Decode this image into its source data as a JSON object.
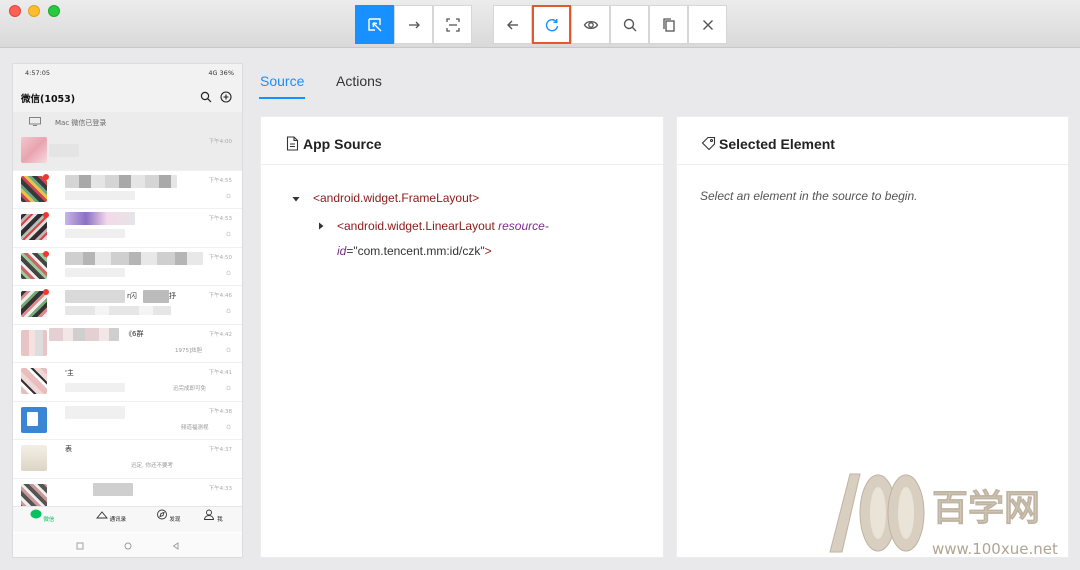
{
  "toolbar": {
    "buttons": [
      {
        "name": "select-element-button",
        "icon": "select-arrow-icon",
        "active": true
      },
      {
        "name": "swipe-button",
        "icon": "swipe-arrow-icon"
      },
      {
        "name": "tap-by-coordinates-button",
        "icon": "crop-frame-icon"
      },
      {
        "name": "back-button",
        "icon": "arrow-left-icon"
      },
      {
        "name": "refresh-button",
        "icon": "refresh-icon",
        "highlighted": true
      },
      {
        "name": "toggle-visibility-button",
        "icon": "eye-icon"
      },
      {
        "name": "search-button",
        "icon": "magnifier-icon"
      },
      {
        "name": "copy-xml-button",
        "icon": "copy-icon"
      },
      {
        "name": "quit-session-button",
        "icon": "close-icon"
      }
    ]
  },
  "tabs": {
    "source": "Source",
    "actions": "Actions"
  },
  "app_source": {
    "title": "App Source",
    "root_tag": "<android.widget.FrameLayout>",
    "child_tag_open": "<android.widget.LinearLayout",
    "child_attr_name": "resource-",
    "child_attr_name_cont": "id",
    "child_attr_eq": "=",
    "child_attr_value": "\"com.tencent.mm:id/czk\"",
    "child_tag_close": ">"
  },
  "selected_element": {
    "title": "Selected Element",
    "hint": "Select an element in the source to begin."
  },
  "phone": {
    "status_time": "4:57:05",
    "status_right": "4G  36%",
    "app_title": "微信(1053)",
    "mac_login": "Mac 微信已登录",
    "chats": [
      {
        "time": "下午4:00",
        "first": true
      },
      {
        "time": "下午4:55",
        "unread": true
      },
      {
        "time": "下午4:53",
        "unread": true
      },
      {
        "time": "下午4:50",
        "unread": true
      },
      {
        "time": "下午4:46",
        "unread": true,
        "text": "r闪",
        "text2": "抒"
      },
      {
        "time": "下午4:42",
        "text": "《6群",
        "text2": "1975]炫胆"
      },
      {
        "time": "下午4:41",
        "text": "'主",
        "text2": "迅完成即可免"
      },
      {
        "time": "下午4:38",
        "text2": "频道福测视"
      },
      {
        "time": "下午4:37",
        "text": "表",
        "text2": "迅定, 你还不要考"
      },
      {
        "time": "下午4:33"
      }
    ],
    "tabbar": [
      "微信",
      "通讯录",
      "发现",
      "我"
    ]
  },
  "watermark": {
    "number": "100",
    "cn": "百学网",
    "url": "www.100xue.net"
  },
  "colors": {
    "accent": "#1890ff",
    "highlight_border": "#e0592f",
    "wechat_green": "#07c160"
  }
}
